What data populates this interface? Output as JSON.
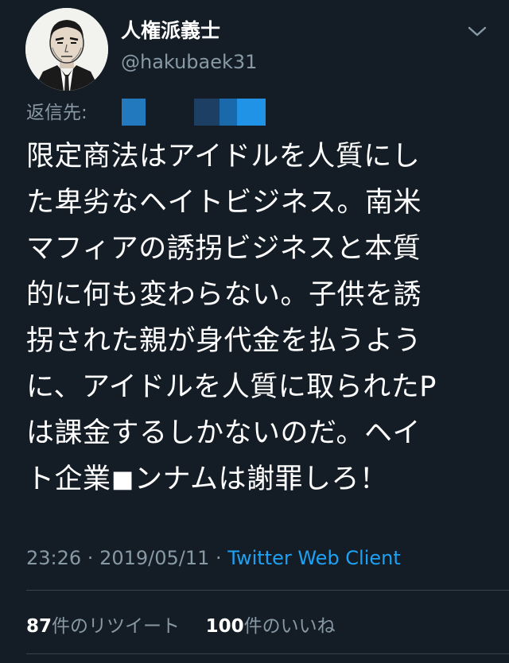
{
  "author": {
    "display_name": "人権派義士",
    "handle": "@hakubaek31",
    "avatar_icon": "avatar-illustration"
  },
  "reply": {
    "label": "返信先:"
  },
  "tweet": {
    "text": "限定商法はアイドルを人質にし\nた卑劣なヘイトビジネス。南米\nマフィアの誘拐ビジネスと本質\n的に何も変わらない。子供を誘\n拐された親が身代金を払うよう\nに、アイドルを人質に取られたP\nは課金するしかないのだ。ヘイ\nト企業◼︎ンナムは謝罪しろ！"
  },
  "meta": {
    "time": "23:26",
    "separator1": " · ",
    "date": "2019/05/11",
    "separator2": " · ",
    "client": "Twitter Web Client"
  },
  "stats": {
    "retweet_count": "87",
    "retweet_label": "件のリツイート",
    "like_count": "100",
    "like_label": "件のいいね"
  },
  "colors": {
    "background": "#141d26",
    "text": "#ffffff",
    "secondary": "#8899a6",
    "link": "#1da1f2",
    "divider": "#38444d"
  }
}
